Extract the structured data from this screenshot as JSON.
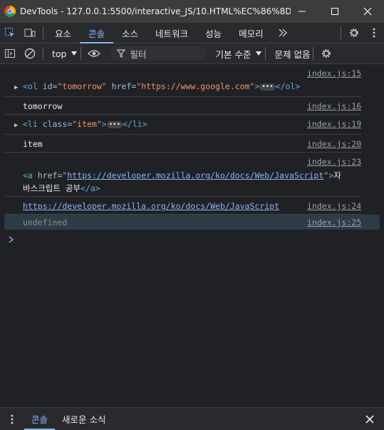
{
  "window": {
    "title": "DevTools - 127.0.0.1:5500/interactive_JS/10.HTML%EC%86%8D%EC..."
  },
  "tabs": [
    "요소",
    "콘솔",
    "소스",
    "네트워크",
    "성능",
    "메모리"
  ],
  "active_tab": "콘솔",
  "toolbar": {
    "context": "top",
    "filter_placeholder": "필터",
    "level": "기본 수준",
    "issues": "문제 없음"
  },
  "console": {
    "messages": [
      {
        "source": "index.js:15",
        "pre": "<ol ",
        "attr1": "id=",
        "val1": "\"tomorrow\"",
        "attr2": " href=",
        "val2": "\"https://www.google.com\"",
        "post": ">",
        "close": "</ol>"
      },
      {
        "source": "index.js:16",
        "text": "tomorrow"
      },
      {
        "source": "index.js:19",
        "pre": "<li ",
        "attr1": "class=",
        "val1": "\"item\"",
        "post": ">",
        "close": "</li>"
      },
      {
        "source": "index.js:20",
        "text": "item"
      },
      {
        "source": "index.js:23",
        "pre": "<a ",
        "attr1": "href=",
        "val1_link": "https://developer.mozilla.org/ko/docs/Web/JavaScript",
        "text_after": "자",
        "line2": "바스크립트 공부",
        "close": "</a>"
      },
      {
        "source": "index.js:24",
        "link": "https://developer.mozilla.org/ko/docs/Web/JavaScript"
      },
      {
        "source": "index.js:25",
        "text": "undefined"
      }
    ]
  },
  "drawer": {
    "tabs": [
      "콘솔",
      "새로운 소식"
    ]
  }
}
